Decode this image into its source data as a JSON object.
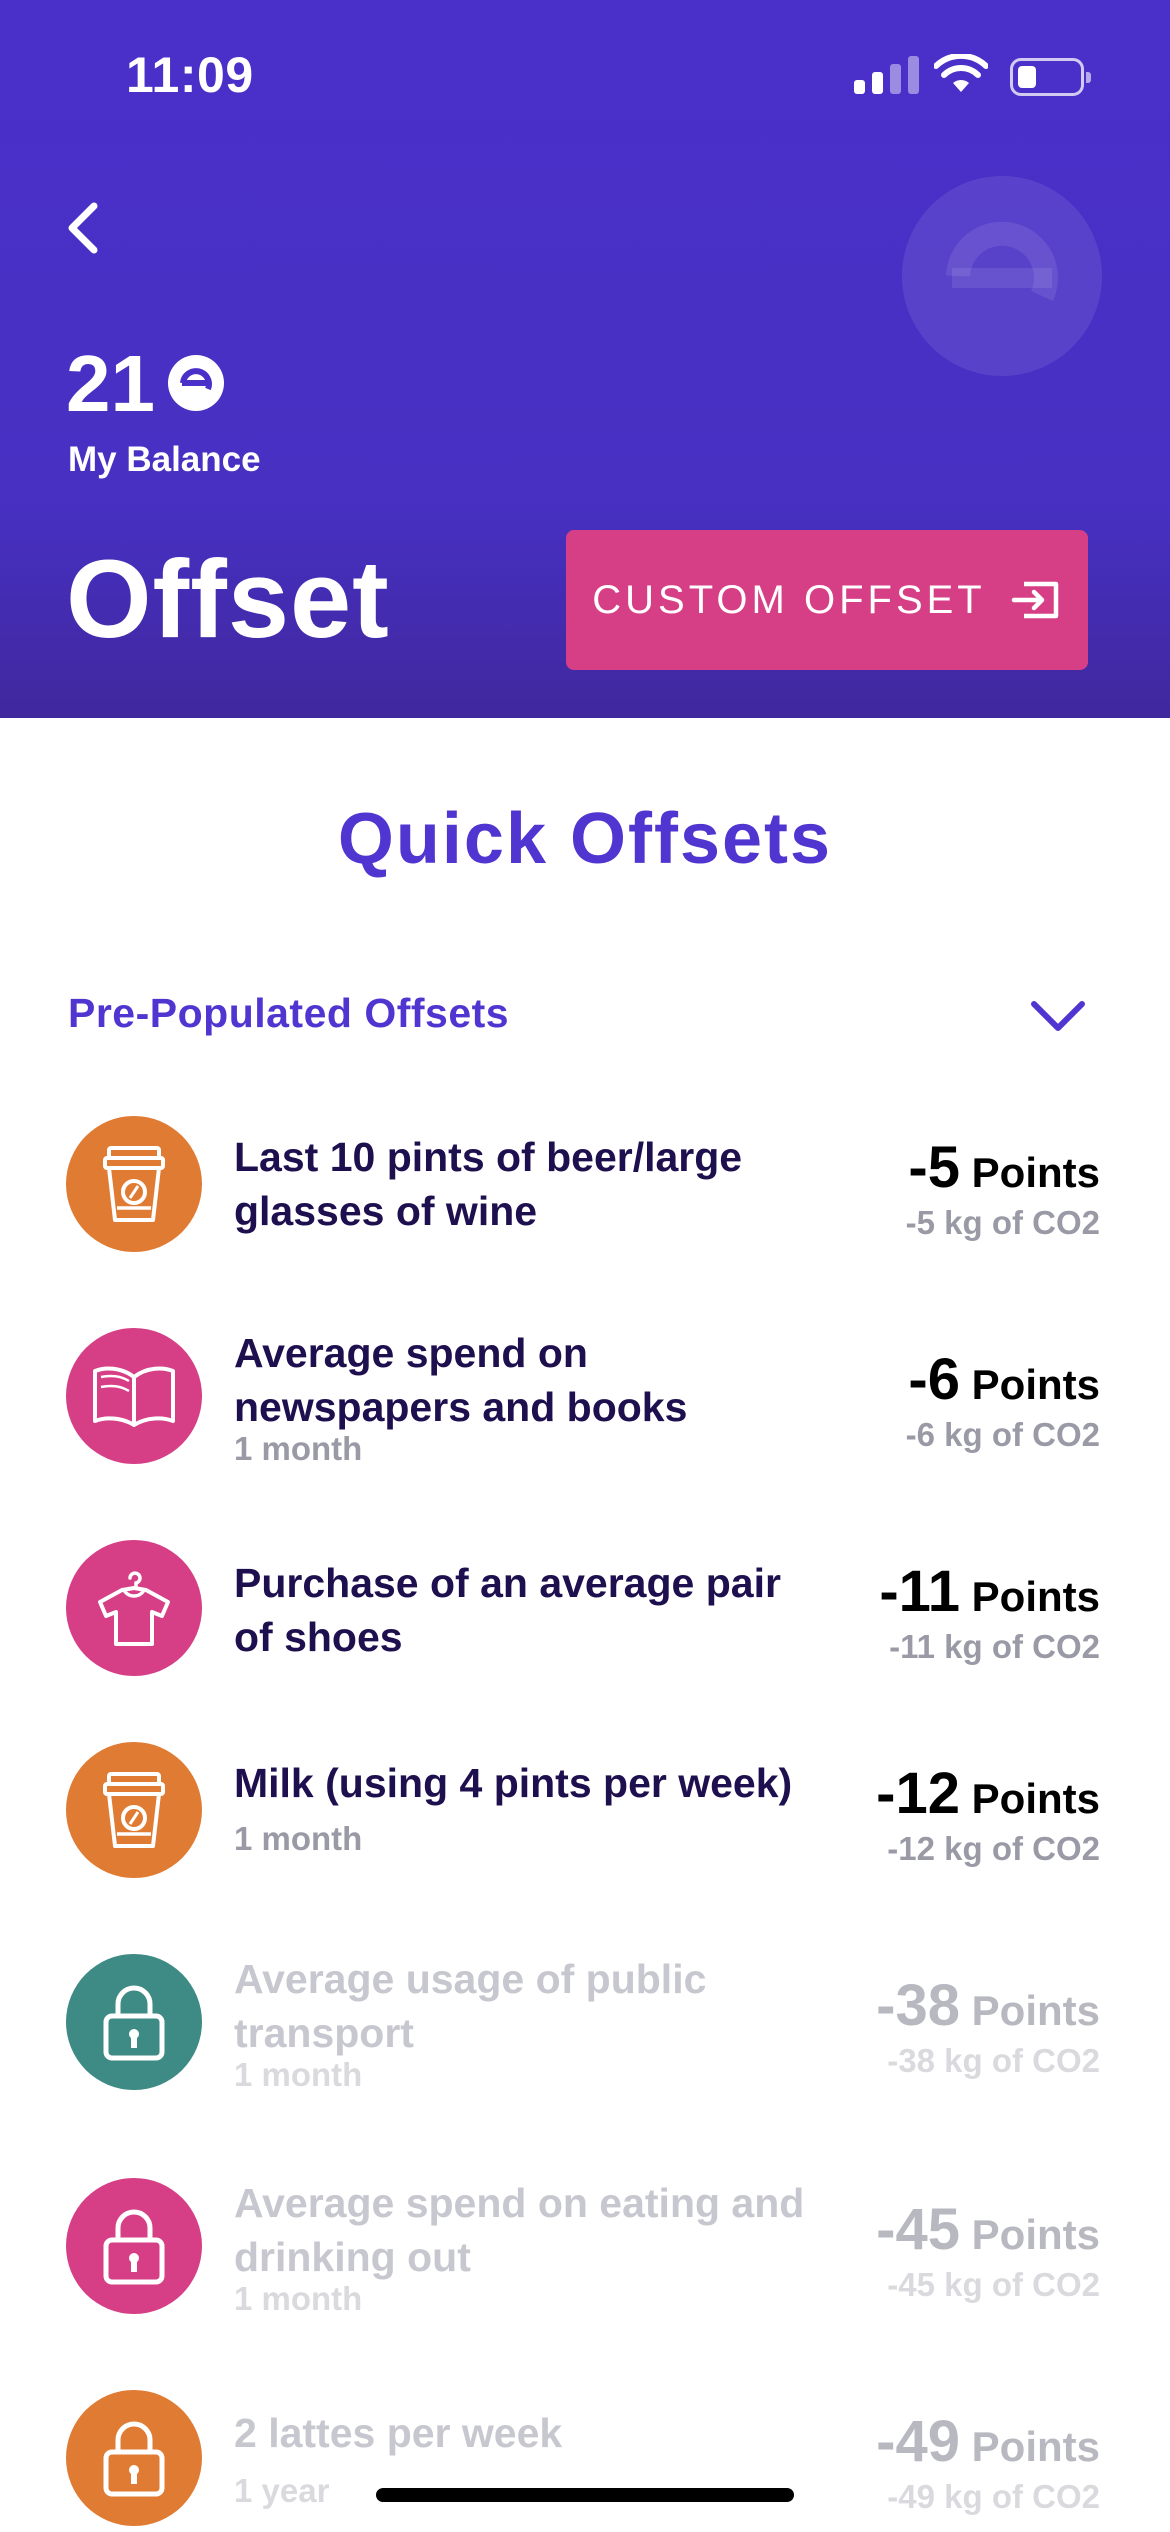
{
  "status_bar": {
    "time": "11:09"
  },
  "header": {
    "balance_value": "21",
    "balance_label": "My Balance",
    "title": "Offset",
    "custom_offset_label": "CUSTOM OFFSET"
  },
  "section_title": "Quick Offsets",
  "subheader": "Pre-Populated Offsets",
  "colors": {
    "brand_purple": "#4a2fc9",
    "accent_pink": "#d63f86",
    "orange": "#e07b34",
    "teal": "#3e8a84"
  },
  "offsets": [
    {
      "title": "Last 10 pints of beer/large glasses of wine",
      "sub": "",
      "points": "-5",
      "points_unit": "Points",
      "co2": "-5 kg of CO2",
      "icon": "coffee-cup-icon",
      "locked": false
    },
    {
      "title": "Average spend on newspapers and books",
      "sub": "1 month",
      "points": "-6",
      "points_unit": "Points",
      "co2": "-6 kg of CO2",
      "icon": "book-icon",
      "locked": false
    },
    {
      "title": "Purchase of an average pair of shoes",
      "sub": "",
      "points": "-11",
      "points_unit": "Points",
      "co2": "-11 kg of CO2",
      "icon": "shirt-hanger-icon",
      "locked": false
    },
    {
      "title": "Milk (using 4 pints per week)",
      "sub": "1 month",
      "points": "-12",
      "points_unit": "Points",
      "co2": "-12 kg of CO2",
      "icon": "coffee-cup-icon",
      "locked": false
    },
    {
      "title": "Average usage of public transport",
      "sub": "1 month",
      "points": "-38",
      "points_unit": "Points",
      "co2": "-38 kg of CO2",
      "icon": "lock-icon",
      "locked": true
    },
    {
      "title": "Average spend on eating and drinking out",
      "sub": "1 month",
      "points": "-45",
      "points_unit": "Points",
      "co2": "-45 kg of CO2",
      "icon": "lock-icon",
      "locked": true
    },
    {
      "title": "2 lattes per week",
      "sub": "1 year",
      "points": "-49",
      "points_unit": "Points",
      "co2": "-49 kg of CO2",
      "icon": "lock-icon",
      "locked": true
    }
  ]
}
